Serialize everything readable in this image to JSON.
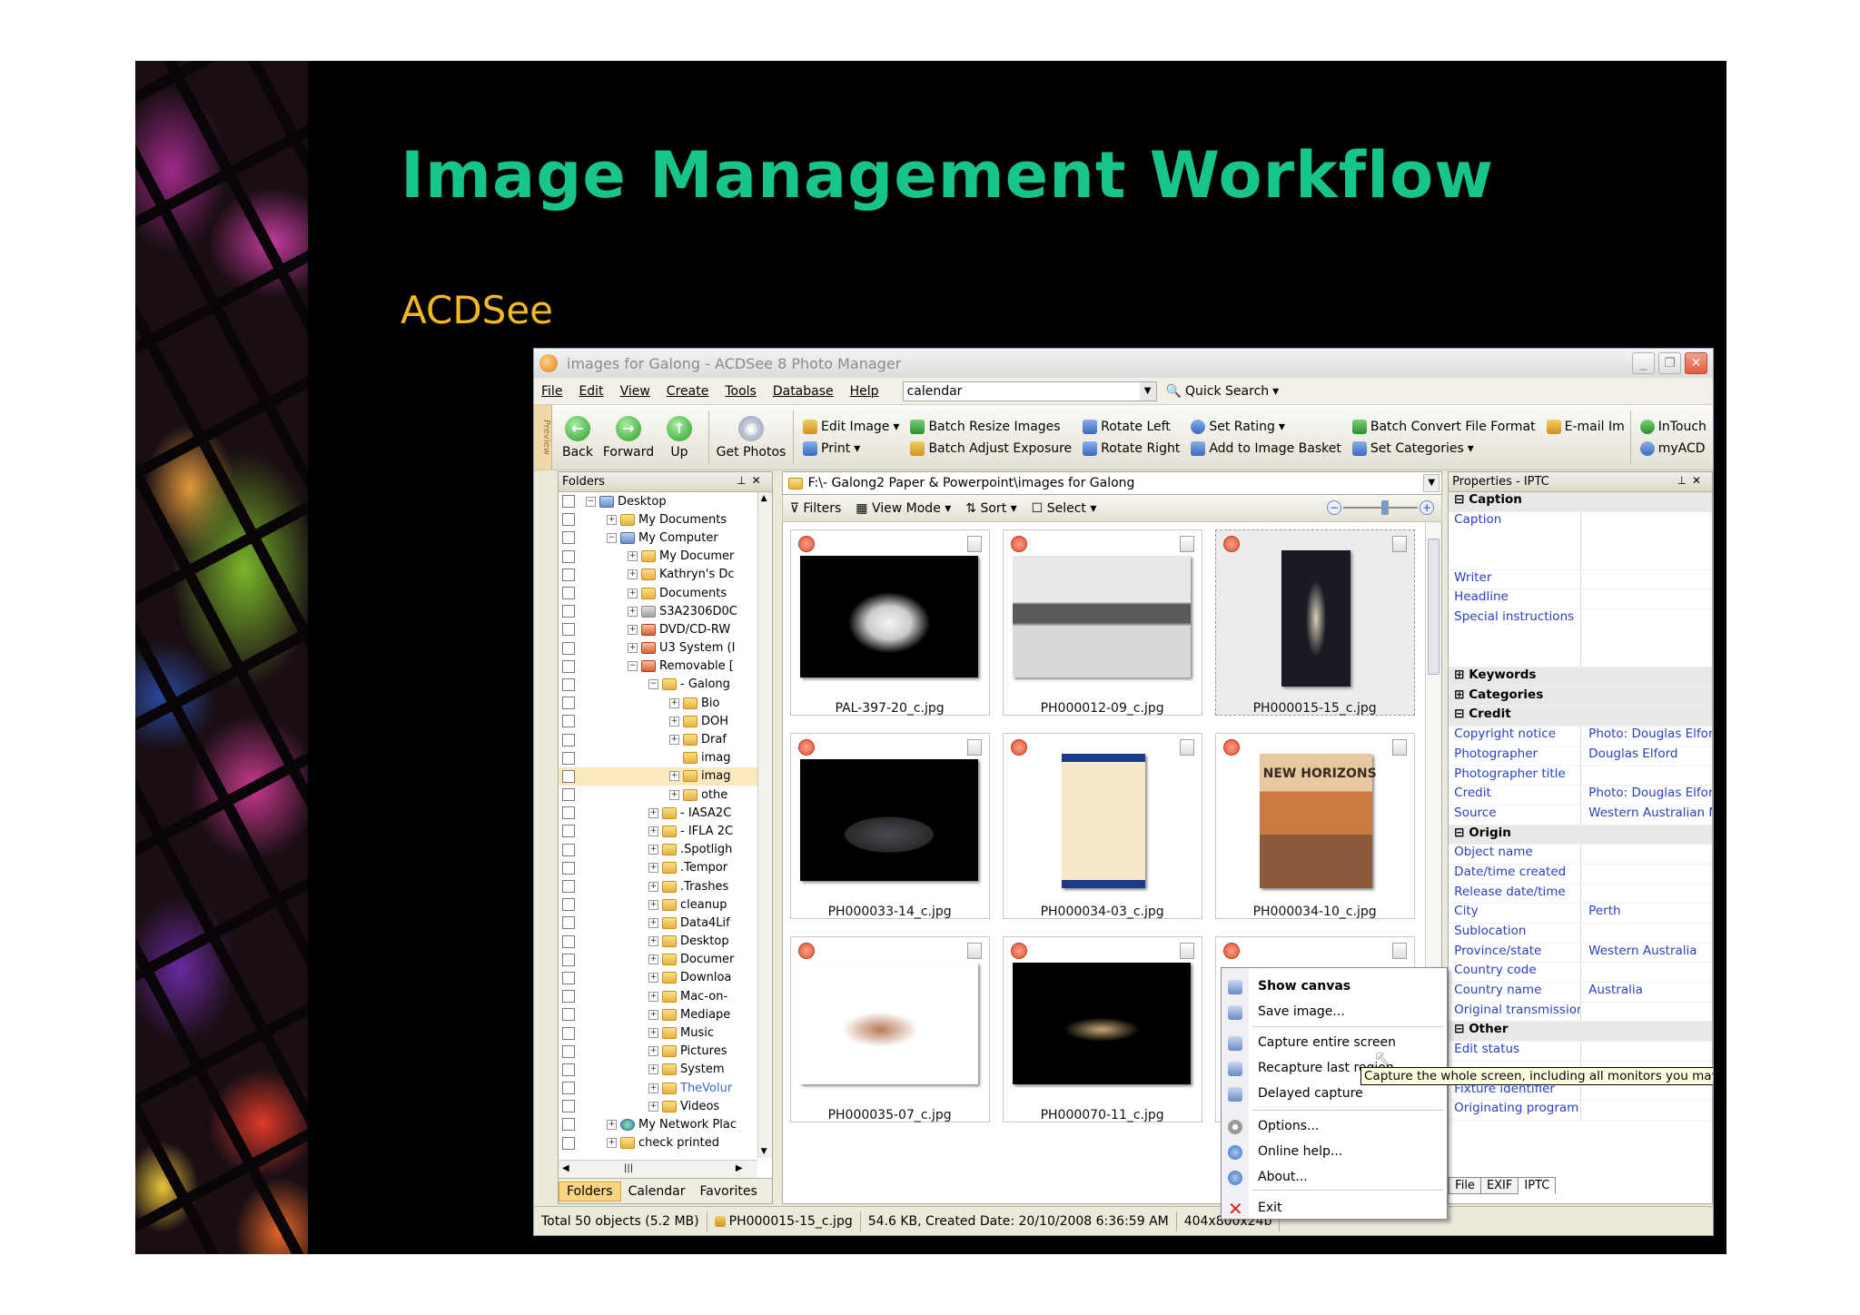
{
  "slide": {
    "title": "Image Management Workflow",
    "subtitle": "ACDSee"
  },
  "window": {
    "title": "images for Galong - ACDSee 8 Photo Manager",
    "buttons": [
      "_",
      "❐",
      "✕"
    ]
  },
  "menu": {
    "items": [
      "File",
      "Edit",
      "View",
      "Create",
      "Tools",
      "Database",
      "Help"
    ],
    "search_value": "calendar",
    "quick_search": "Quick Search"
  },
  "toolbar": {
    "preview_tab": "Preview",
    "back": "Back",
    "forward": "Forward",
    "up": "Up",
    "get_photos": "Get Photos",
    "edit_image": "Edit Image",
    "print": "Print",
    "batch_resize": "Batch Resize Images",
    "batch_adjust": "Batch Adjust Exposure",
    "rotate_left": "Rotate Left",
    "rotate_right": "Rotate Right",
    "set_rating": "Set Rating",
    "add_basket": "Add to Image Basket",
    "batch_convert": "Batch Convert File Format",
    "set_categories": "Set Categories",
    "email": "E-mail Im",
    "intouch": "InTouch",
    "myacd": "myACD"
  },
  "folders": {
    "header": "Folders",
    "tree": [
      {
        "label": "Desktop",
        "indent": 0,
        "pm": "−",
        "icon": "comp"
      },
      {
        "label": "My Documents",
        "indent": 1,
        "pm": "+",
        "icon": "folder"
      },
      {
        "label": "My Computer",
        "indent": 1,
        "pm": "−",
        "icon": "comp"
      },
      {
        "label": "My Documer",
        "indent": 2,
        "pm": "+",
        "icon": "folder"
      },
      {
        "label": "Kathryn's Dc",
        "indent": 2,
        "pm": "+",
        "icon": "folder"
      },
      {
        "label": "Documents",
        "indent": 2,
        "pm": "+",
        "icon": "folder"
      },
      {
        "label": "S3A2306D0C",
        "indent": 2,
        "pm": "+",
        "icon": "drv"
      },
      {
        "label": "DVD/CD-RW",
        "indent": 2,
        "pm": "+",
        "icon": "red"
      },
      {
        "label": "U3 System (I",
        "indent": 2,
        "pm": "+",
        "icon": "red"
      },
      {
        "label": "Removable [",
        "indent": 2,
        "pm": "−",
        "icon": "red"
      },
      {
        "label": "- Galong",
        "indent": 3,
        "pm": "−",
        "icon": "folder"
      },
      {
        "label": "Bio",
        "indent": 4,
        "pm": "+",
        "icon": "folder"
      },
      {
        "label": "DOH",
        "indent": 4,
        "pm": "+",
        "icon": "folder"
      },
      {
        "label": "Draf",
        "indent": 4,
        "pm": "+",
        "icon": "folder"
      },
      {
        "label": "imag",
        "indent": 4,
        "pm": "",
        "icon": "folder"
      },
      {
        "label": "imag",
        "indent": 4,
        "pm": "+",
        "icon": "folder",
        "selected": true
      },
      {
        "label": "othe",
        "indent": 4,
        "pm": "+",
        "icon": "folder"
      },
      {
        "label": "- IASA2C",
        "indent": 3,
        "pm": "+",
        "icon": "folder"
      },
      {
        "label": "- IFLA 2C",
        "indent": 3,
        "pm": "+",
        "icon": "folder"
      },
      {
        "label": ".Spotligh",
        "indent": 3,
        "pm": "+",
        "icon": "folder"
      },
      {
        "label": ".Tempor",
        "indent": 3,
        "pm": "+",
        "icon": "folder"
      },
      {
        "label": ".Trashes",
        "indent": 3,
        "pm": "+",
        "icon": "folder"
      },
      {
        "label": "cleanup",
        "indent": 3,
        "pm": "+",
        "icon": "folder"
      },
      {
        "label": "Data4Lif",
        "indent": 3,
        "pm": "+",
        "icon": "folder"
      },
      {
        "label": "Desktop",
        "indent": 3,
        "pm": "+",
        "icon": "folder"
      },
      {
        "label": "Documer",
        "indent": 3,
        "pm": "+",
        "icon": "folder"
      },
      {
        "label": "Downloa",
        "indent": 3,
        "pm": "+",
        "icon": "folder"
      },
      {
        "label": "Mac-on-",
        "indent": 3,
        "pm": "+",
        "icon": "folder"
      },
      {
        "label": "Mediape",
        "indent": 3,
        "pm": "+",
        "icon": "folder"
      },
      {
        "label": "Music",
        "indent": 3,
        "pm": "+",
        "icon": "folder"
      },
      {
        "label": "Pictures",
        "indent": 3,
        "pm": "+",
        "icon": "folder"
      },
      {
        "label": "System",
        "indent": 3,
        "pm": "+",
        "icon": "folder"
      },
      {
        "label": "TheVolur",
        "indent": 3,
        "pm": "+",
        "icon": "folder"
      },
      {
        "label": "Videos",
        "indent": 3,
        "pm": "+",
        "icon": "folder"
      },
      {
        "label": "My Network Plac",
        "indent": 1,
        "pm": "+",
        "icon": "net"
      },
      {
        "label": "check printed",
        "indent": 1,
        "pm": "+",
        "icon": "folder"
      }
    ],
    "tabs": [
      "Folders",
      "Calendar",
      "Favorites"
    ]
  },
  "content": {
    "path": "F:\\- Galong2  Paper & Powerpoint\\images for Galong",
    "filters": "Filters",
    "view_mode": "View Mode",
    "sort": "Sort",
    "select": "Select",
    "thumbnails": [
      {
        "name": "PAL-397-20_c.jpg"
      },
      {
        "name": "PH000012-09_c.jpg"
      },
      {
        "name": "PH000015-15_c.jpg",
        "selected": true
      },
      {
        "name": "PH000033-14_c.jpg"
      },
      {
        "name": "PH000034-03_c.jpg"
      },
      {
        "name": "PH000034-10_c.jpg",
        "poster_text": "NEW HORIZONS"
      },
      {
        "name": "PH000035-07_c.jpg"
      },
      {
        "name": "PH000070-11_c.jpg"
      },
      {
        "name": ""
      }
    ]
  },
  "properties": {
    "header": "Properties - IPTC",
    "rows": [
      {
        "type": "sec",
        "k": "Caption"
      },
      {
        "type": "tall3",
        "k": "Caption",
        "v": ""
      },
      {
        "k": "Writer",
        "v": ""
      },
      {
        "k": "Headline",
        "v": ""
      },
      {
        "type": "tall3",
        "k": "Special instructions",
        "v": ""
      },
      {
        "type": "sec",
        "k": "Keywords"
      },
      {
        "type": "sec",
        "k": "Categories"
      },
      {
        "type": "sec",
        "k": "Credit"
      },
      {
        "k": "Copyright notice",
        "v": "Photo: Douglas Elfor..."
      },
      {
        "k": "Photographer",
        "v": "Douglas Elford"
      },
      {
        "k": "Photographer title",
        "v": ""
      },
      {
        "k": "Credit",
        "v": "Photo: Douglas Elford"
      },
      {
        "k": "Source",
        "v": "Western Australian M..."
      },
      {
        "type": "sec",
        "k": "Origin"
      },
      {
        "k": "Object name",
        "v": ""
      },
      {
        "k": "Date/time created",
        "v": ""
      },
      {
        "k": "Release date/time",
        "v": ""
      },
      {
        "k": "City",
        "v": "Perth"
      },
      {
        "k": "Sublocation",
        "v": ""
      },
      {
        "k": "Province/state",
        "v": "Western Australia"
      },
      {
        "k": "Country code",
        "v": ""
      },
      {
        "k": "Country name",
        "v": "Australia"
      },
      {
        "k": "Original transmission ...",
        "v": ""
      },
      {
        "type": "sec",
        "k": "Other"
      },
      {
        "k": "Edit status",
        "v": ""
      },
      {
        "k": "",
        "v": ""
      },
      {
        "k": "Fixture identifier",
        "v": ""
      },
      {
        "k": "Originating program",
        "v": ""
      }
    ],
    "tabs": [
      "File",
      "EXIF",
      "IPTC"
    ]
  },
  "status": {
    "total": "Total 50 objects  (5.2 MB)",
    "file": "PH000015-15_c.jpg",
    "info": "54.6 KB, Created Date: 20/10/2008 6:36:59 AM",
    "dims": "404x800x24b"
  },
  "context_menu": {
    "items": [
      "Show canvas",
      "Save image...",
      "Capture entire screen",
      "Recapture last region",
      "Delayed capture",
      "Options...",
      "Online help...",
      "About...",
      "Exit"
    ]
  },
  "tooltip": "Capture the whole screen, including all monitors you may have"
}
